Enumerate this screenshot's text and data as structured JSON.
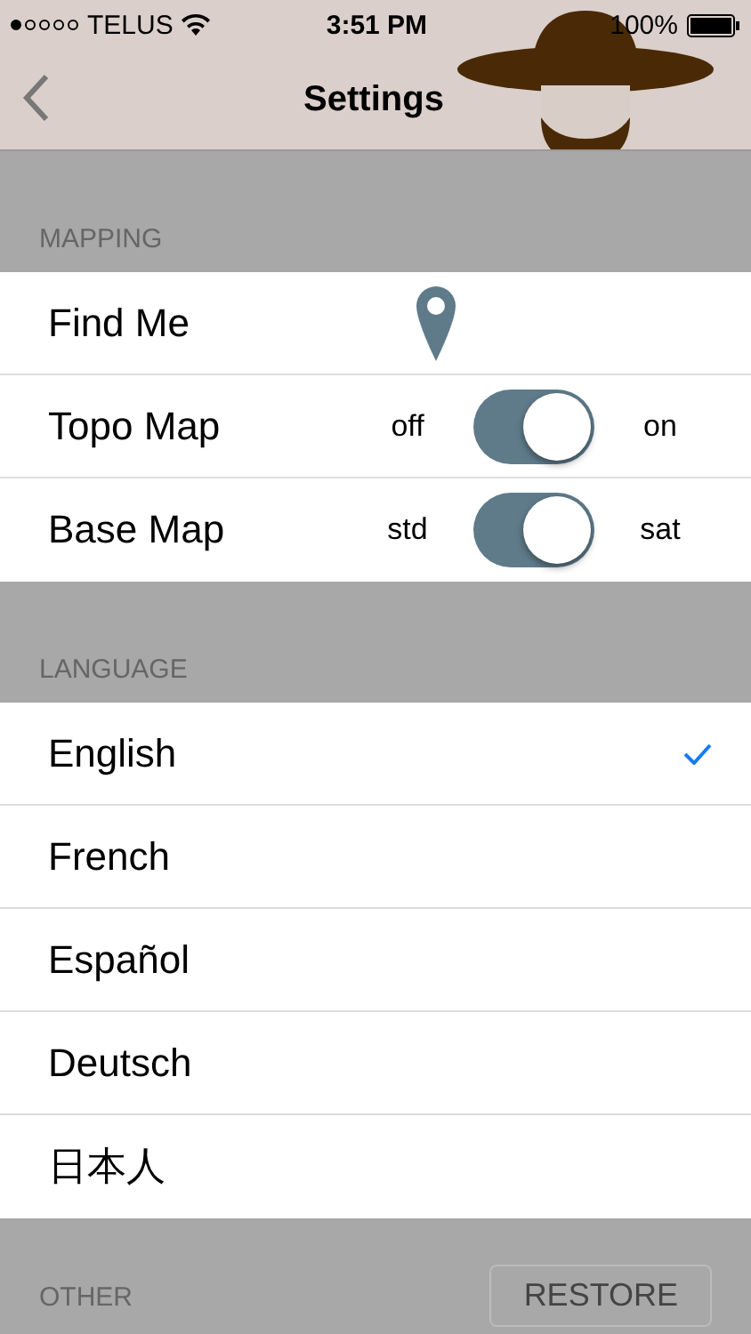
{
  "status_bar": {
    "carrier": "TELUS",
    "time": "3:51 PM",
    "battery": "100%"
  },
  "nav": {
    "title": "Settings"
  },
  "mapping": {
    "header": "MAPPING",
    "rows": [
      {
        "kind": "button",
        "label": "Find Me"
      },
      {
        "kind": "toggle",
        "label": "Topo Map",
        "off_label": "off",
        "on_label": "on",
        "on": true
      },
      {
        "kind": "toggle",
        "label": "Base Map",
        "off_label": "std",
        "on_label": "sat",
        "on": true
      }
    ]
  },
  "language": {
    "header": "LANGUAGE",
    "items": [
      {
        "label": "English",
        "selected": true
      },
      {
        "label": "French",
        "selected": false
      },
      {
        "label": "Español",
        "selected": false
      },
      {
        "label": "Deutsch",
        "selected": false
      },
      {
        "label": "日本人",
        "selected": false
      }
    ]
  },
  "other": {
    "header": "OTHER",
    "button": "RESTORE"
  }
}
